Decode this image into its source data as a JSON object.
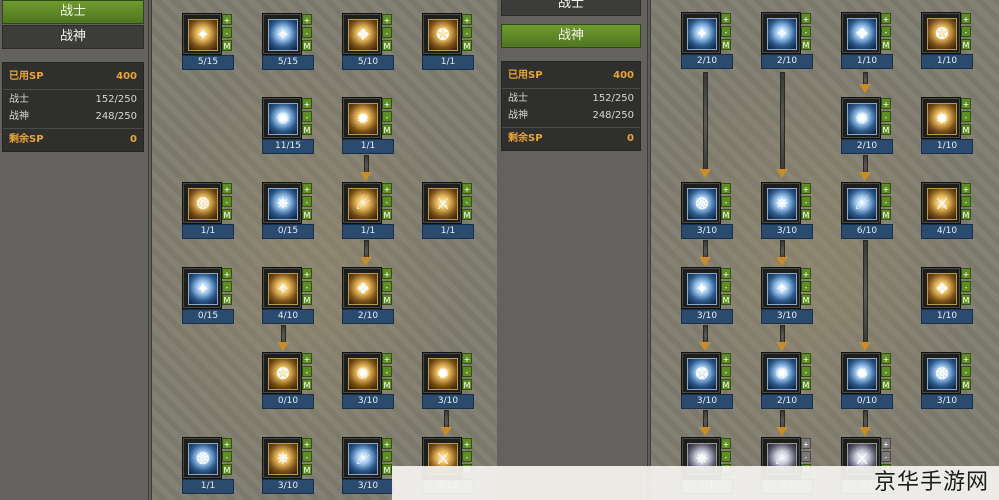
{
  "left_panel": {
    "tabs": [
      {
        "label": "战士",
        "active": true
      },
      {
        "label": "战神",
        "active": false
      }
    ],
    "sp": {
      "used_label": "已用SP",
      "used_value": "400",
      "rows": [
        {
          "label": "战士",
          "value": "152/250"
        },
        {
          "label": "战神",
          "value": "248/250"
        }
      ],
      "remaining_label": "剩余SP",
      "remaining_value": "0"
    }
  },
  "mid_panel": {
    "tabs": [
      {
        "label": "战士",
        "active": false
      },
      {
        "label": "战神",
        "active": true
      }
    ],
    "sp": {
      "used_label": "已用SP",
      "used_value": "400",
      "rows": [
        {
          "label": "战士",
          "value": "152/250"
        },
        {
          "label": "战神",
          "value": "248/250"
        }
      ],
      "remaining_label": "剩余SP",
      "remaining_value": "0"
    }
  },
  "skill_buttons": {
    "plus": "+",
    "minus": "-",
    "max": "M"
  },
  "grid1_skills": [
    {
      "level": "5/15",
      "icon": "clenched-fist-icon"
    },
    {
      "level": "5/15",
      "icon": "blade-slash-icon"
    },
    {
      "level": "5/10",
      "icon": "flame-burst-icon"
    },
    {
      "level": "1/1",
      "icon": "armor-icon"
    },
    {
      "level": "11/15",
      "icon": "sword-icon"
    },
    {
      "level": "1/1",
      "icon": "wing-strike-icon"
    },
    {
      "level": "1/1",
      "icon": "jumping-warrior-icon"
    },
    {
      "level": "0/15",
      "icon": "blade-storm-icon"
    },
    {
      "level": "1/1",
      "icon": "rising-fist-icon"
    },
    {
      "level": "1/1",
      "icon": "shield-arm-icon"
    },
    {
      "level": "0/15",
      "icon": "blue-aura-icon"
    },
    {
      "level": "4/10",
      "icon": "running-warrior-icon"
    },
    {
      "level": "2/10",
      "icon": "whirlwind-icon"
    },
    {
      "level": "0/10",
      "icon": "power-punch-icon"
    },
    {
      "level": "3/10",
      "icon": "leap-attack-icon"
    },
    {
      "level": "3/10",
      "icon": "charge-icon"
    },
    {
      "level": "1/1",
      "icon": "ice-orb-icon"
    },
    {
      "level": "3/10",
      "icon": "golden-orb-icon"
    },
    {
      "level": "3/10",
      "icon": "spirit-burst-icon"
    },
    {
      "level": "2/10",
      "icon": "radiant-burst-icon"
    }
  ],
  "grid2_skills": [
    {
      "level": "2/10",
      "icon": "ice-pillar-icon"
    },
    {
      "level": "2/10",
      "icon": "axe-icon"
    },
    {
      "level": "1/10",
      "icon": "war-mask-icon"
    },
    {
      "level": "1/10",
      "icon": "flame-wing-icon"
    },
    {
      "level": "2/10",
      "icon": "spirit-beast-icon"
    },
    {
      "level": "1/10",
      "icon": "golden-ring-icon"
    },
    {
      "level": "3/10",
      "icon": "dash-icon"
    },
    {
      "level": "3/10",
      "icon": "orb-throw-icon"
    },
    {
      "level": "6/10",
      "icon": "demon-face-icon"
    },
    {
      "level": "4/10",
      "icon": "fire-vortex-icon"
    },
    {
      "level": "3/10",
      "icon": "cyclone-icon"
    },
    {
      "level": "3/10",
      "icon": "ice-fountain-icon"
    },
    {
      "level": "1/10",
      "icon": "sun-burst-icon"
    },
    {
      "level": "3/10",
      "icon": "storm-slash-icon"
    },
    {
      "level": "2/10",
      "icon": "water-spiral-icon"
    },
    {
      "level": "0/10",
      "icon": "beast-roar-icon"
    },
    {
      "level": "3/10",
      "icon": "ghost-face-icon"
    },
    {
      "level": "1/1",
      "icon": "purple-crystal-icon"
    },
    {
      "level": "0/1",
      "icon": "light-pillar-icon"
    },
    {
      "level": "0/1",
      "icon": "dragon-skull-icon"
    }
  ],
  "watermark": "京华手游网"
}
